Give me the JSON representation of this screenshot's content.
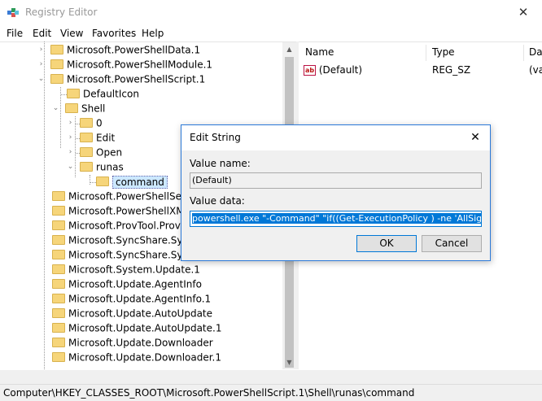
{
  "window": {
    "title": "Registry Editor",
    "close_glyph": "✕",
    "icon": "registry-editor-icon"
  },
  "menu": [
    "File",
    "Edit",
    "View",
    "Favorites",
    "Help"
  ],
  "tree": {
    "items": [
      {
        "label": "Microsoft.PowerShellData.1",
        "expander": "›"
      },
      {
        "label": "Microsoft.PowerShellModule.1",
        "expander": "›"
      },
      {
        "label": "Microsoft.PowerShellScript.1",
        "expander": "⌄"
      },
      {
        "label": "DefaultIcon",
        "expander": ""
      },
      {
        "label": "Shell",
        "expander": "⌄"
      },
      {
        "label": "0",
        "expander": "›"
      },
      {
        "label": "Edit",
        "expander": "›"
      },
      {
        "label": "Open",
        "expander": "›"
      },
      {
        "label": "runas",
        "expander": "⌄"
      },
      {
        "label": "command",
        "expander": ""
      },
      {
        "label": "Microsoft.PowerShellSessionConfiguration.1",
        "expander": ""
      },
      {
        "label": "Microsoft.PowerShellXMLData.1",
        "expander": ""
      },
      {
        "label": "Microsoft.ProvTool.Provisioning.1",
        "expander": ""
      },
      {
        "label": "Microsoft.SyncShare.SyncShareFactory.1",
        "expander": ""
      },
      {
        "label": "Microsoft.SyncShare.SyncShareFactory",
        "expander": ""
      },
      {
        "label": "Microsoft.System.Update.1",
        "expander": ""
      },
      {
        "label": "Microsoft.Update.AgentInfo",
        "expander": ""
      },
      {
        "label": "Microsoft.Update.AgentInfo.1",
        "expander": ""
      },
      {
        "label": "Microsoft.Update.AutoUpdate",
        "expander": ""
      },
      {
        "label": "Microsoft.Update.AutoUpdate.1",
        "expander": ""
      },
      {
        "label": "Microsoft.Update.Downloader",
        "expander": ""
      },
      {
        "label": "Microsoft.Update.Downloader.1",
        "expander": ""
      }
    ],
    "scroll_up": "▲",
    "scroll_down": "▼"
  },
  "list": {
    "columns": [
      "Name",
      "Type",
      "Data"
    ],
    "rows": [
      {
        "icon": "ab",
        "name": "(Default)",
        "type": "REG_SZ",
        "data": "(value not set)"
      }
    ]
  },
  "statusbar": {
    "path": "Computer\\HKEY_CLASSES_ROOT\\Microsoft.PowerShellScript.1\\Shell\\runas\\command"
  },
  "dialog": {
    "title": "Edit String",
    "close_glyph": "✕",
    "value_name_label": "Value name:",
    "value_name": "(Default)",
    "value_data_label": "Value data:",
    "value_data": "powershell.exe \"-Command\" \"if((Get-ExecutionPolicy ) -ne 'AllSigned') { Set-ExecutionPolicy -Scope Process Bypass }; & '%1'\"",
    "ok_label": "OK",
    "cancel_label": "Cancel"
  },
  "colors": {
    "accent": "#0078d7",
    "selection": "#cce8ff",
    "folder": "#f6d57a"
  }
}
